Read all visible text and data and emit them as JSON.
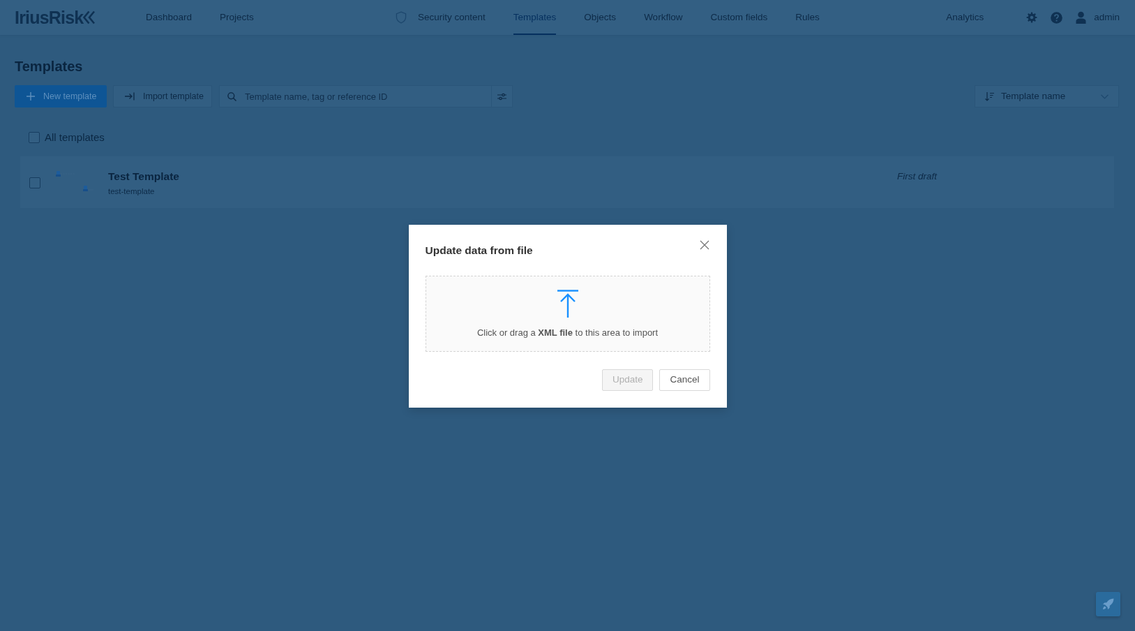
{
  "navbar": {
    "logo": "IriusRisk",
    "nav_left": [
      {
        "label": "Dashboard",
        "selected": false
      },
      {
        "label": "Projects",
        "selected": false
      }
    ],
    "nav_center": [
      {
        "label": "Security content",
        "selected": false
      },
      {
        "label": "Templates",
        "selected": true
      },
      {
        "label": "Objects",
        "selected": false
      },
      {
        "label": "Workflow",
        "selected": false
      },
      {
        "label": "Custom fields",
        "selected": false
      },
      {
        "label": "Rules",
        "selected": false
      }
    ],
    "analytics": "Analytics",
    "user": "admin"
  },
  "page": {
    "title": "Templates",
    "new_button": "New template",
    "import_button": "Import template",
    "search": {
      "placeholder": "Template name, tag or reference ID"
    },
    "sort": {
      "value": "Template name"
    },
    "select_all": {
      "label": "All templates",
      "checked": false
    },
    "templates": [
      {
        "name": "Test Template",
        "slug": "test-template",
        "status": "First draft",
        "checked": false
      }
    ]
  },
  "modal": {
    "title": "Update data from file",
    "dropzone_text": "Click or drag a **XML file** to this area to import",
    "buttons": [
      {
        "label": "Update",
        "disabled": true
      },
      {
        "label": "Cancel",
        "disabled": false
      }
    ]
  }
}
